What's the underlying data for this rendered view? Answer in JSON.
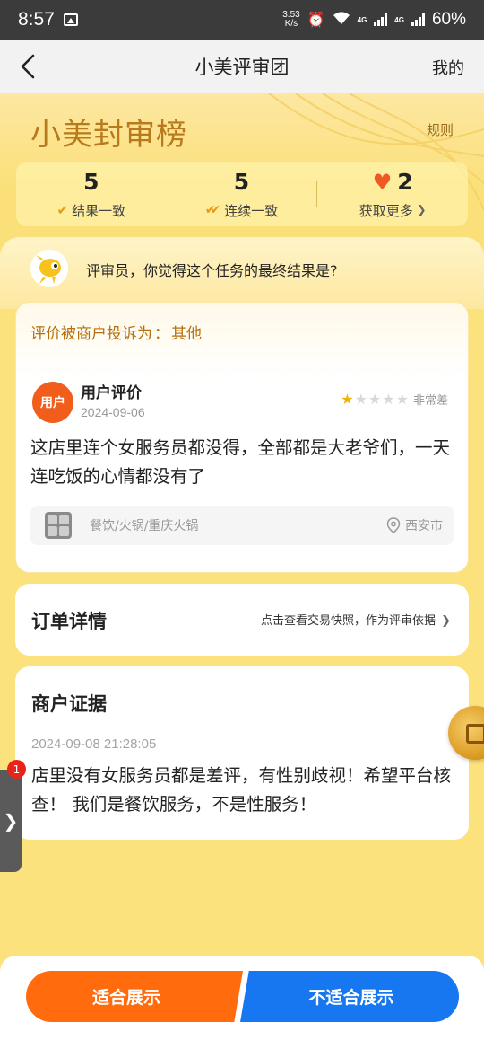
{
  "status_bar": {
    "time": "8:57",
    "speed_value": "3.53",
    "speed_unit": "K/s",
    "network_label_1": "4G",
    "network_label_2": "4G",
    "battery": "60%"
  },
  "header": {
    "title": "小美评审团",
    "right_link": "我的"
  },
  "banner": {
    "brand": "小美封审榜",
    "rules_link": "规则"
  },
  "stats": [
    {
      "value": "5",
      "label": "结果一致"
    },
    {
      "value": "5",
      "label": "连续一致"
    },
    {
      "value": "2",
      "label": "获取更多"
    }
  ],
  "prompt": {
    "text": "评审员，你觉得这个任务的最终结果是?"
  },
  "complaint": {
    "prefix": "评价被商户投诉为",
    "separator": "：",
    "reason": "其他"
  },
  "review": {
    "avatar_label": "用户",
    "title": "用户评价",
    "date": "2024-09-06",
    "rating": 1,
    "rating_max": 5,
    "rating_label": "非常差",
    "body": "这店里连个女服务员都没得，全部都是大老爷们，一天连吃饭的心情都没有了",
    "category": "餐饮/火锅/重庆火锅",
    "city": "西安市"
  },
  "order": {
    "title": "订单详情",
    "link": "点击查看交易快照，作为评审依据"
  },
  "evidence": {
    "title": "商户证据",
    "time": "2024-09-08 21:28:05",
    "body": "店里没有女服务员都是差评，有性别歧视！希望平台核查！ 我们是餐饮服务，不是性服务！"
  },
  "side_tab": {
    "badge": "1",
    "arrow": "❯"
  },
  "actions": {
    "suitable": "适合展示",
    "unsuitable": "不适合展示"
  },
  "colors": {
    "accent_orange": "#ff6b0d",
    "accent_blue": "#1777f0",
    "banner_yellow": "#fbe27c",
    "brand_gold": "#b87a1c"
  },
  "icons": {
    "back": "chevron-left-icon",
    "check": "check-icon",
    "double_check": "double-check-icon",
    "heart": "heart-icon",
    "star": "star-icon",
    "location": "location-pin-icon",
    "coin": "coin-icon"
  }
}
